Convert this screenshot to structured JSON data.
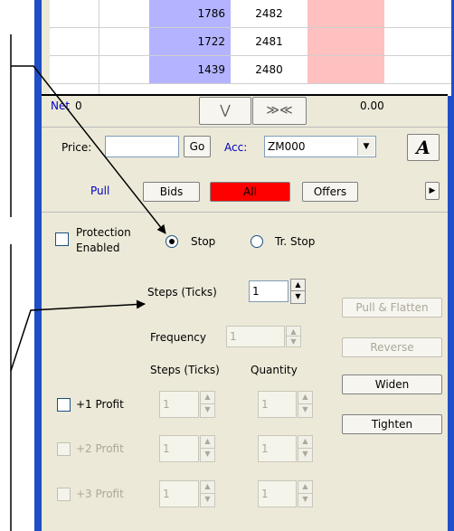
{
  "table": {
    "rows": [
      {
        "left": "1786",
        "right": "2482"
      },
      {
        "left": "1722",
        "right": "2481"
      },
      {
        "left": "1439",
        "right": "2480"
      }
    ]
  },
  "net_bar": {
    "net_label": "Net",
    "net_value": "0",
    "pnl_value": "0.00",
    "collapse_glyph": "⋁",
    "center_glyph": "≫≪"
  },
  "order_bar": {
    "price_label": "Price:",
    "price_value": "",
    "go_label": "Go",
    "account_label": "Acc:",
    "account_value": "ZM000",
    "font_button": "A"
  },
  "filter_bar": {
    "pull_label": "Pull",
    "bids_label": "Bids",
    "all_label": "All",
    "offers_label": "Offers",
    "expand_icon": "caret-right-icon",
    "accent_all": "#ff0000"
  },
  "protection": {
    "enabled_line1": "Protection",
    "enabled_line2": "Enabled",
    "stop_label": "Stop",
    "trailing_stop_label": "Tr. Stop",
    "selected": "Stop",
    "steps_label": "Steps (Ticks)",
    "steps_value": "1",
    "frequency_label": "Frequency",
    "frequency_value": "1",
    "pull_flatten_label": "Pull & Flatten",
    "reverse_label": "Reverse",
    "col_steps_label": "Steps (Ticks)",
    "col_quantity_label": "Quantity",
    "widen_label": "Widen",
    "tighten_label": "Tighten"
  },
  "profits": [
    {
      "label": "+1 Profit",
      "steps": "1",
      "quantity": "1"
    },
    {
      "label": "+2 Profit",
      "steps": "1",
      "quantity": "1"
    },
    {
      "label": "+3 Profit",
      "steps": "1",
      "quantity": "1"
    }
  ],
  "colors": {
    "frame": "#1f4fc6",
    "bid_column": "#b3b3ff",
    "ask_column": "#ffc0c0",
    "net_text": "#0000c0",
    "pull_text": "#0000c0"
  }
}
